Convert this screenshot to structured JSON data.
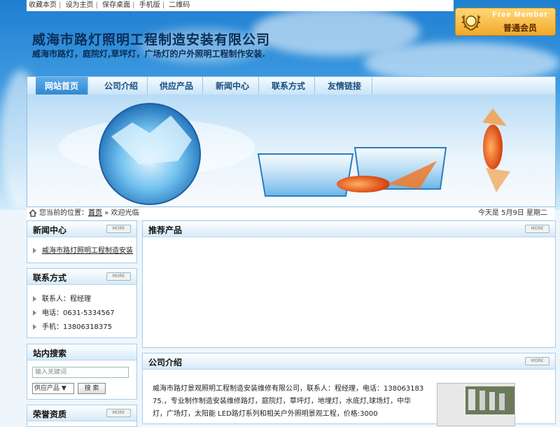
{
  "topbar": {
    "links": [
      "收藏本页",
      "设为主页",
      "保存桌面",
      "手机版",
      "二维码"
    ]
  },
  "member": {
    "title": "Free Member",
    "level": "普通会员"
  },
  "header": {
    "company": "威海市路灯照明工程制造安装有限公司",
    "slogan": "威海市路灯，庭院灯,草坪灯，广场灯的户外照明工程制作安装."
  },
  "nav": {
    "items": [
      "网站首页",
      "公司介绍",
      "供应产品",
      "新闻中心",
      "联系方式",
      "友情链接"
    ]
  },
  "breadcrumb": {
    "prefix": "您当前的位置：",
    "home": "首页",
    "separator": "»",
    "current": "欢迎光临",
    "date": "今天是 5月9日 星期二"
  },
  "news": {
    "title": "新闻中心",
    "more": "MORE",
    "items": [
      "威海市路灯照明工程制造安装"
    ]
  },
  "contact": {
    "title": "联系方式",
    "more": "MORE",
    "person": "联系人：程经理",
    "phone": "电话：0631-5334567",
    "mobile": "手机：13806318375"
  },
  "search": {
    "title": "站内搜索",
    "placeholder": "输入关键词",
    "category": "供应产品",
    "button": "搜 索"
  },
  "honor": {
    "title": "荣誉资质",
    "more": "MORE"
  },
  "recommend": {
    "title": "推荐产品",
    "more": "MORE"
  },
  "about": {
    "title": "公司介绍",
    "more": "MORE",
    "line1": "威海市路灯景观照明工程制造安装维修有限公司，联系人：程经理，电话：138063183",
    "line2": "75.，专业制作制造安装维修路灯，庭院灯，草坪灯，地埋灯，水底灯,球场灯，中华",
    "line3": "灯，广场灯，太阳能 LED路灯系列和相关户外照明景观工程，价格:3000"
  },
  "colors": {
    "accent": "#2f86cf",
    "border": "#a9cce8",
    "title": "#0b2d57"
  }
}
